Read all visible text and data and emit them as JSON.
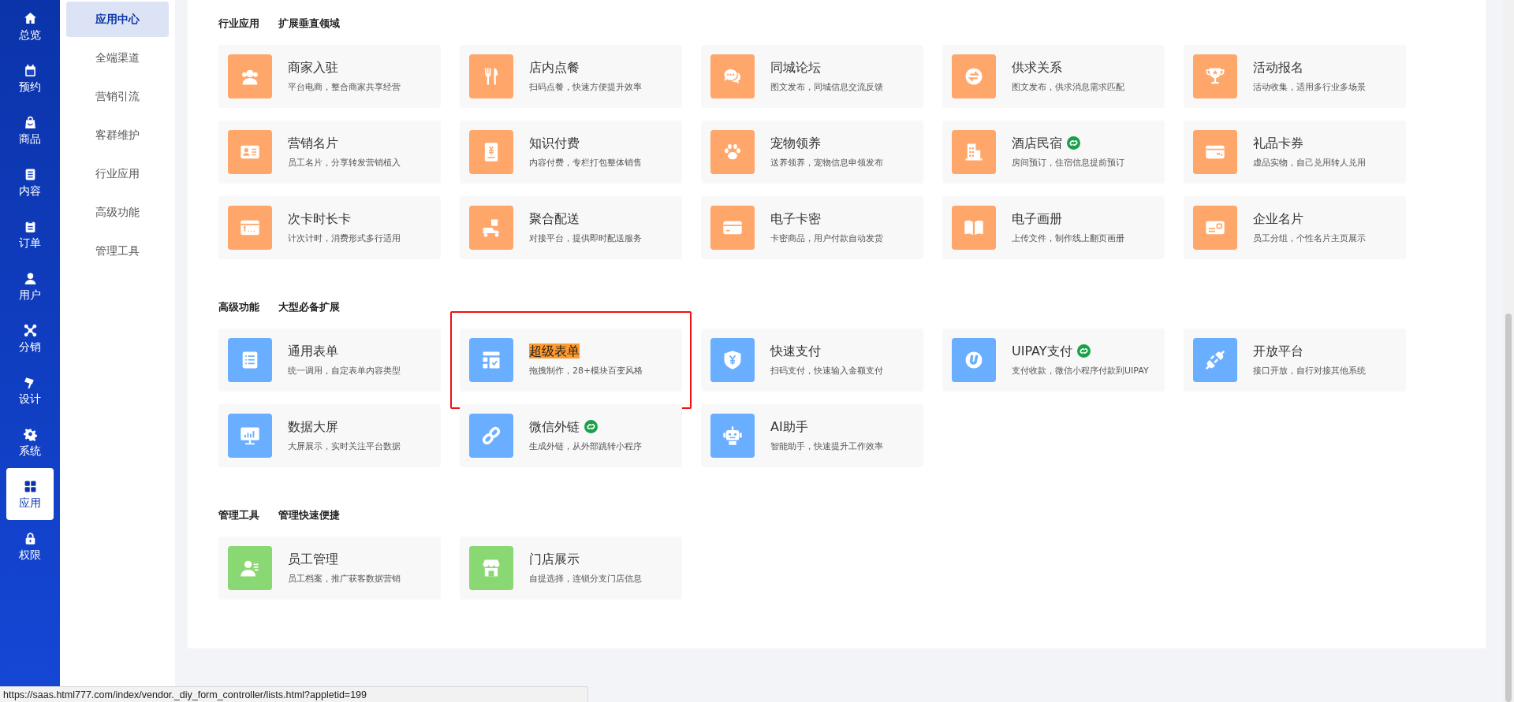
{
  "sidebar": {
    "items": [
      {
        "label": "总览",
        "selected": false
      },
      {
        "label": "预约",
        "selected": false
      },
      {
        "label": "商品",
        "selected": false
      },
      {
        "label": "内容",
        "selected": false
      },
      {
        "label": "订单",
        "selected": false
      },
      {
        "label": "用户",
        "selected": false
      },
      {
        "label": "分销",
        "selected": false
      },
      {
        "label": "设计",
        "selected": false
      },
      {
        "label": "系统",
        "selected": false
      },
      {
        "label": "应用",
        "selected": true
      },
      {
        "label": "权限",
        "selected": false
      }
    ]
  },
  "subnav": {
    "items": [
      {
        "label": "应用中心",
        "selected": true
      },
      {
        "label": "全端渠道",
        "selected": false
      },
      {
        "label": "营销引流",
        "selected": false
      },
      {
        "label": "客群维护",
        "selected": false
      },
      {
        "label": "行业应用",
        "selected": false
      },
      {
        "label": "高级功能",
        "selected": false
      },
      {
        "label": "管理工具",
        "selected": false
      }
    ]
  },
  "sections": [
    {
      "title": "行业应用",
      "subtitle": "扩展垂直领域",
      "color": "#ffa76a",
      "cards": [
        {
          "title": "商家入驻",
          "desc": "平台电商，整合商家共享经营",
          "badge": false,
          "highlighted": false
        },
        {
          "title": "店内点餐",
          "desc": "扫码点餐，快速方便提升效率",
          "badge": false,
          "highlighted": false
        },
        {
          "title": "同城论坛",
          "desc": "图文发布，同城信息交流反馈",
          "badge": false,
          "highlighted": false
        },
        {
          "title": "供求关系",
          "desc": "图文发布，供求消息需求匹配",
          "badge": false,
          "highlighted": false
        },
        {
          "title": "活动报名",
          "desc": "活动收集，适用多行业多场景",
          "badge": false,
          "highlighted": false
        },
        {
          "title": "营销名片",
          "desc": "员工名片，分享转发营销植入",
          "badge": false,
          "highlighted": false
        },
        {
          "title": "知识付费",
          "desc": "内容付费，专栏打包整体销售",
          "badge": false,
          "highlighted": false
        },
        {
          "title": "宠物领养",
          "desc": "送养领养，宠物信息申领发布",
          "badge": false,
          "highlighted": false
        },
        {
          "title": "酒店民宿",
          "desc": "房间预订，住宿信息提前预订",
          "badge": true,
          "highlighted": false
        },
        {
          "title": "礼品卡券",
          "desc": "虚品实物，自己兑用转人兑用",
          "badge": false,
          "highlighted": false
        },
        {
          "title": "次卡时长卡",
          "desc": "计次计时，消费形式多行适用",
          "badge": false,
          "highlighted": false
        },
        {
          "title": "聚合配送",
          "desc": "对接平台，提供即时配送服务",
          "badge": false,
          "highlighted": false
        },
        {
          "title": "电子卡密",
          "desc": "卡密商品，用户付款自动发货",
          "badge": false,
          "highlighted": false
        },
        {
          "title": "电子画册",
          "desc": "上传文件，制作线上翻页画册",
          "badge": false,
          "highlighted": false
        },
        {
          "title": "企业名片",
          "desc": "员工分组，个性名片主页展示",
          "badge": false,
          "highlighted": false
        }
      ]
    },
    {
      "title": "高级功能",
      "subtitle": "大型必备扩展",
      "color": "#6aaeff",
      "cards": [
        {
          "title": "通用表单",
          "desc": "统一调用，自定表单内容类型",
          "badge": false,
          "highlighted": false
        },
        {
          "title": "超级表单",
          "desc": "拖拽制作，28+模块百变风格",
          "badge": false,
          "highlighted": true
        },
        {
          "title": "快速支付",
          "desc": "扫码支付，快速输入金额支付",
          "badge": false,
          "highlighted": false
        },
        {
          "title": "UIPAY支付",
          "desc": "支付收款，微信小程序付款到UIPAY",
          "badge": true,
          "highlighted": false
        },
        {
          "title": "开放平台",
          "desc": "接口开放，自行对接其他系统",
          "badge": false,
          "highlighted": false
        },
        {
          "title": "数据大屏",
          "desc": "大屏展示，实时关注平台数据",
          "badge": false,
          "highlighted": false
        },
        {
          "title": "微信外链",
          "desc": "生成外链，从外部跳转小程序",
          "badge": true,
          "highlighted": false
        },
        {
          "title": "AI助手",
          "desc": "智能助手，快速提升工作效率",
          "badge": false,
          "highlighted": false
        }
      ]
    },
    {
      "title": "管理工具",
      "subtitle": "管理快速便捷",
      "color": "#8ad873",
      "cards": [
        {
          "title": "员工管理",
          "desc": "员工档案，推广获客数据营销",
          "badge": false,
          "highlighted": false
        },
        {
          "title": "门店展示",
          "desc": "自提选择，连锁分支门店信息",
          "badge": false,
          "highlighted": false
        }
      ]
    }
  ],
  "status_bar": {
    "url": "https://saas.html777.com/index/vendor._diy_form_controller/lists.html?appletid=199"
  }
}
